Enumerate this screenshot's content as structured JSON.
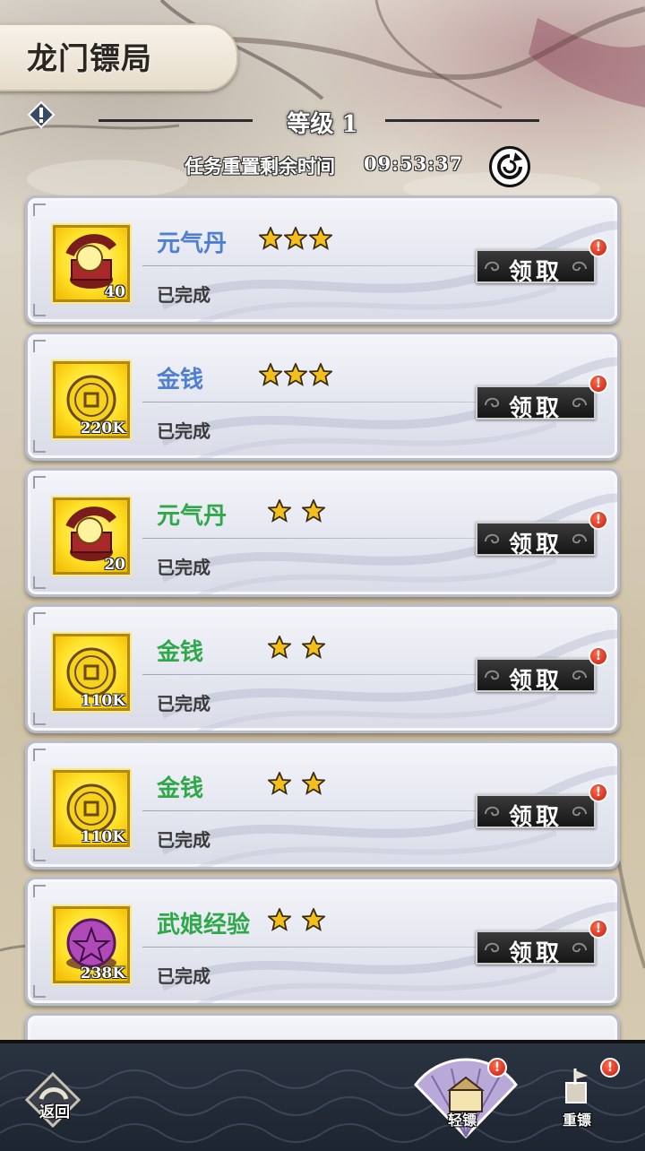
{
  "header": {
    "title": "龙门镖局",
    "level": "等级 1",
    "reset_label": "任务重置剩余时间",
    "reset_time": "09:53:37"
  },
  "tasks": [
    {
      "item": "元气丹",
      "stars": 3,
      "name_color": "#4f7fd2",
      "quantity": "40",
      "status": "已完成",
      "button": "领取",
      "icon": "pill-box-icon"
    },
    {
      "item": "金钱",
      "stars": 3,
      "name_color": "#4f7fd2",
      "quantity": "220K",
      "status": "已完成",
      "button": "领取",
      "icon": "coin-icon"
    },
    {
      "item": "元气丹",
      "stars": 2,
      "name_color": "#2fa84a",
      "quantity": "20",
      "status": "已完成",
      "button": "领取",
      "icon": "pill-box-icon"
    },
    {
      "item": "金钱",
      "stars": 2,
      "name_color": "#2fa84a",
      "quantity": "110K",
      "status": "已完成",
      "button": "领取",
      "icon": "coin-icon"
    },
    {
      "item": "金钱",
      "stars": 2,
      "name_color": "#2fa84a",
      "quantity": "110K",
      "status": "已完成",
      "button": "领取",
      "icon": "coin-icon"
    },
    {
      "item": "武娘经验",
      "stars": 2,
      "name_color": "#2fa84a",
      "quantity": "238K",
      "status": "已完成",
      "button": "领取",
      "icon": "experience-orb-icon"
    }
  ],
  "bottom_nav": {
    "back_label": "返回",
    "tabs": [
      {
        "label": "轻镖",
        "active": true,
        "icon": "light-escort-icon"
      },
      {
        "label": "重镖",
        "active": false,
        "icon": "heavy-escort-icon"
      }
    ]
  },
  "colors": {
    "star": "#f2c018",
    "badge": "#d02a1c",
    "claim_button": "#1f1f1f",
    "icon_gold": "#ffe22a"
  }
}
